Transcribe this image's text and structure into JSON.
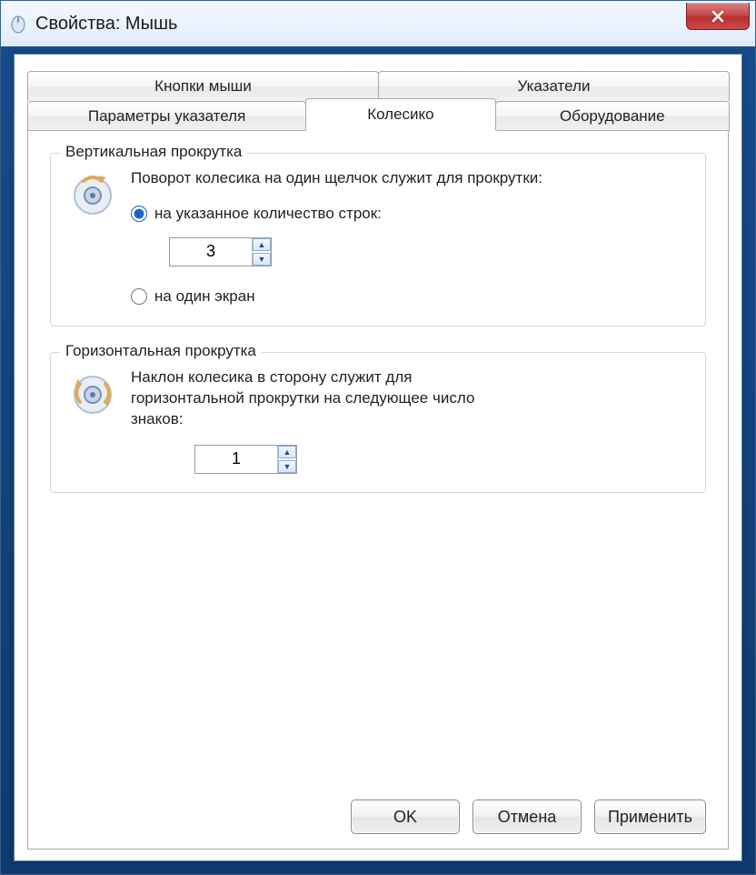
{
  "window": {
    "title": "Свойства: Мышь",
    "close_icon": "close-icon"
  },
  "tabs": {
    "row1": [
      "Кнопки мыши",
      "Указатели"
    ],
    "row2": [
      "Параметры указателя",
      "Колесико",
      "Оборудование"
    ],
    "active": "Колесико"
  },
  "vertical": {
    "title": "Вертикальная прокрутка",
    "caption": "Поворот колесика на один щелчок служит для прокрутки:",
    "opt_lines": "на указанное количество строк:",
    "lines_value": "3",
    "opt_screen": "на один экран",
    "selected": "lines"
  },
  "horizontal": {
    "title": "Горизонтальная прокрутка",
    "caption": "Наклон колесика в сторону служит для горизонтальной прокрутки на следующее число знаков:",
    "value": "1"
  },
  "buttons": {
    "ok": "OK",
    "cancel": "Отмена",
    "apply": "Применить"
  },
  "icons": {
    "mouse": "mouse-icon",
    "wheel_vertical": "wheel-vertical-icon",
    "wheel_horizontal": "wheel-horizontal-icon"
  }
}
